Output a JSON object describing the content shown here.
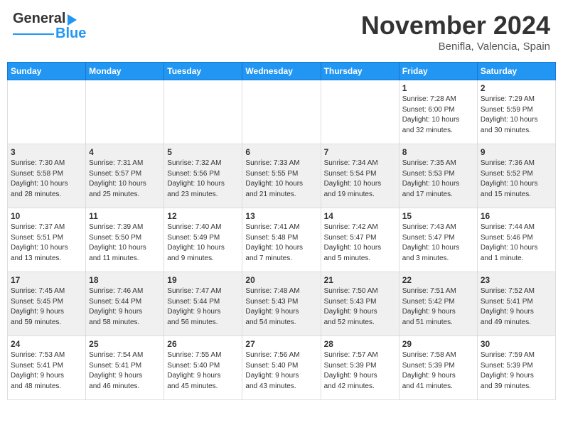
{
  "header": {
    "logo_line1": "General",
    "logo_line2": "Blue",
    "month": "November 2024",
    "location": "Benifla, Valencia, Spain"
  },
  "days_of_week": [
    "Sunday",
    "Monday",
    "Tuesday",
    "Wednesday",
    "Thursday",
    "Friday",
    "Saturday"
  ],
  "weeks": [
    [
      {
        "day": "",
        "info": ""
      },
      {
        "day": "",
        "info": ""
      },
      {
        "day": "",
        "info": ""
      },
      {
        "day": "",
        "info": ""
      },
      {
        "day": "",
        "info": ""
      },
      {
        "day": "1",
        "info": "Sunrise: 7:28 AM\nSunset: 6:00 PM\nDaylight: 10 hours\nand 32 minutes."
      },
      {
        "day": "2",
        "info": "Sunrise: 7:29 AM\nSunset: 5:59 PM\nDaylight: 10 hours\nand 30 minutes."
      }
    ],
    [
      {
        "day": "3",
        "info": "Sunrise: 7:30 AM\nSunset: 5:58 PM\nDaylight: 10 hours\nand 28 minutes."
      },
      {
        "day": "4",
        "info": "Sunrise: 7:31 AM\nSunset: 5:57 PM\nDaylight: 10 hours\nand 25 minutes."
      },
      {
        "day": "5",
        "info": "Sunrise: 7:32 AM\nSunset: 5:56 PM\nDaylight: 10 hours\nand 23 minutes."
      },
      {
        "day": "6",
        "info": "Sunrise: 7:33 AM\nSunset: 5:55 PM\nDaylight: 10 hours\nand 21 minutes."
      },
      {
        "day": "7",
        "info": "Sunrise: 7:34 AM\nSunset: 5:54 PM\nDaylight: 10 hours\nand 19 minutes."
      },
      {
        "day": "8",
        "info": "Sunrise: 7:35 AM\nSunset: 5:53 PM\nDaylight: 10 hours\nand 17 minutes."
      },
      {
        "day": "9",
        "info": "Sunrise: 7:36 AM\nSunset: 5:52 PM\nDaylight: 10 hours\nand 15 minutes."
      }
    ],
    [
      {
        "day": "10",
        "info": "Sunrise: 7:37 AM\nSunset: 5:51 PM\nDaylight: 10 hours\nand 13 minutes."
      },
      {
        "day": "11",
        "info": "Sunrise: 7:39 AM\nSunset: 5:50 PM\nDaylight: 10 hours\nand 11 minutes."
      },
      {
        "day": "12",
        "info": "Sunrise: 7:40 AM\nSunset: 5:49 PM\nDaylight: 10 hours\nand 9 minutes."
      },
      {
        "day": "13",
        "info": "Sunrise: 7:41 AM\nSunset: 5:48 PM\nDaylight: 10 hours\nand 7 minutes."
      },
      {
        "day": "14",
        "info": "Sunrise: 7:42 AM\nSunset: 5:47 PM\nDaylight: 10 hours\nand 5 minutes."
      },
      {
        "day": "15",
        "info": "Sunrise: 7:43 AM\nSunset: 5:47 PM\nDaylight: 10 hours\nand 3 minutes."
      },
      {
        "day": "16",
        "info": "Sunrise: 7:44 AM\nSunset: 5:46 PM\nDaylight: 10 hours\nand 1 minute."
      }
    ],
    [
      {
        "day": "17",
        "info": "Sunrise: 7:45 AM\nSunset: 5:45 PM\nDaylight: 9 hours\nand 59 minutes."
      },
      {
        "day": "18",
        "info": "Sunrise: 7:46 AM\nSunset: 5:44 PM\nDaylight: 9 hours\nand 58 minutes."
      },
      {
        "day": "19",
        "info": "Sunrise: 7:47 AM\nSunset: 5:44 PM\nDaylight: 9 hours\nand 56 minutes."
      },
      {
        "day": "20",
        "info": "Sunrise: 7:48 AM\nSunset: 5:43 PM\nDaylight: 9 hours\nand 54 minutes."
      },
      {
        "day": "21",
        "info": "Sunrise: 7:50 AM\nSunset: 5:43 PM\nDaylight: 9 hours\nand 52 minutes."
      },
      {
        "day": "22",
        "info": "Sunrise: 7:51 AM\nSunset: 5:42 PM\nDaylight: 9 hours\nand 51 minutes."
      },
      {
        "day": "23",
        "info": "Sunrise: 7:52 AM\nSunset: 5:41 PM\nDaylight: 9 hours\nand 49 minutes."
      }
    ],
    [
      {
        "day": "24",
        "info": "Sunrise: 7:53 AM\nSunset: 5:41 PM\nDaylight: 9 hours\nand 48 minutes."
      },
      {
        "day": "25",
        "info": "Sunrise: 7:54 AM\nSunset: 5:41 PM\nDaylight: 9 hours\nand 46 minutes."
      },
      {
        "day": "26",
        "info": "Sunrise: 7:55 AM\nSunset: 5:40 PM\nDaylight: 9 hours\nand 45 minutes."
      },
      {
        "day": "27",
        "info": "Sunrise: 7:56 AM\nSunset: 5:40 PM\nDaylight: 9 hours\nand 43 minutes."
      },
      {
        "day": "28",
        "info": "Sunrise: 7:57 AM\nSunset: 5:39 PM\nDaylight: 9 hours\nand 42 minutes."
      },
      {
        "day": "29",
        "info": "Sunrise: 7:58 AM\nSunset: 5:39 PM\nDaylight: 9 hours\nand 41 minutes."
      },
      {
        "day": "30",
        "info": "Sunrise: 7:59 AM\nSunset: 5:39 PM\nDaylight: 9 hours\nand 39 minutes."
      }
    ]
  ]
}
